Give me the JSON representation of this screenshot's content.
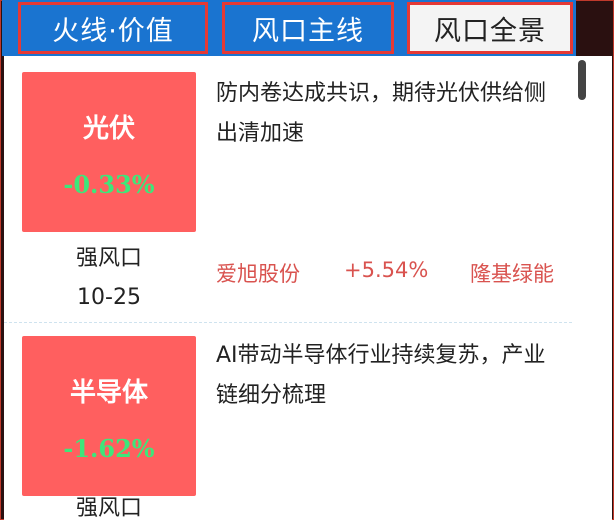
{
  "tabs": [
    {
      "label": "火线·价值"
    },
    {
      "label": "风口主线"
    },
    {
      "label": "风口全景"
    }
  ],
  "cards": [
    {
      "sector": "光伏",
      "change": "-0.33%",
      "strength": "强风口",
      "date": "10-25",
      "description": "防内卷达成共识，期待光伏供给侧出清加速",
      "stocks": [
        "爱旭股份",
        "+5.54%",
        "隆基绿能"
      ]
    },
    {
      "sector": "半导体",
      "change": "-1.62%",
      "strength": "强风口",
      "description": "AI带动半导体行业持续复苏，产业链细分梳理"
    }
  ],
  "colors": {
    "tabbar": "#1a74d0",
    "tab_border": "#e53935",
    "tile": "#ff5f5f",
    "change_text": "#3ee67a",
    "stock_text": "#d9534f"
  }
}
